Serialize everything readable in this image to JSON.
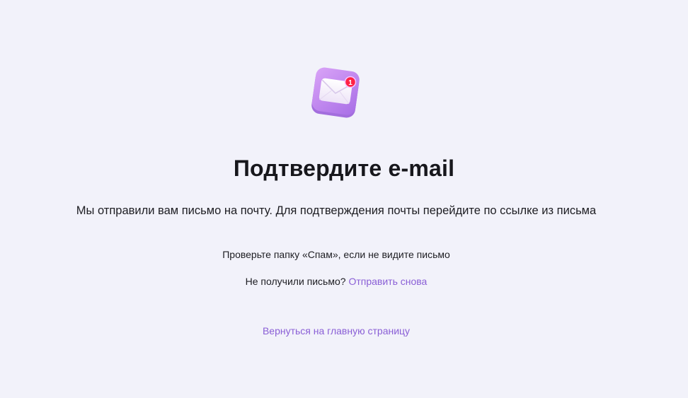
{
  "icon": {
    "name": "envelope-notification-icon",
    "badge_count": "1",
    "colors": {
      "tile": "#c98af2",
      "tile_dark": "#a86ee6",
      "envelope": "#fbf7ff",
      "badge": "#ff2244"
    }
  },
  "title": "Подтвердите e-mail",
  "subtitle": "Мы отправили вам письмо на почту. Для подтверждения почты перейдите по ссылке из письма",
  "spam_note": "Проверьте папку «Спам», если не видите письмо",
  "resend": {
    "prompt": "Не получили письмо?",
    "link_label": "Отправить снова"
  },
  "home_link_label": "Вернуться на главную страницу",
  "colors": {
    "background": "#f2f2fa",
    "link": "#8a5fd6",
    "text": "#1d1d22"
  }
}
